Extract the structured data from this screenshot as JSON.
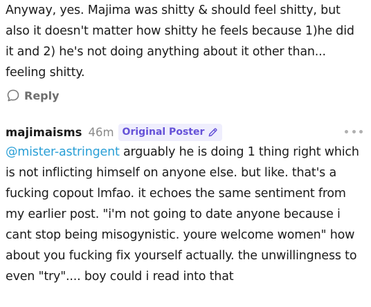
{
  "previous_comment": {
    "text": "Anyway, yes. Majima was shitty & should feel shitty, but also it doesn't matter how shitty he feels because 1)he did it and 2) he's not doing anything about it other than... feeling shitty."
  },
  "reply": {
    "label": "Reply",
    "icon": "speech-bubble-icon"
  },
  "comment": {
    "username": "majimaisms",
    "timestamp": "46m",
    "badge_label": "Original Poster",
    "badge_icon": "pencil-icon",
    "mention": "@mister-astringent",
    "body": " arguably he is doing 1 thing right which is not inflicting himself on anyone else. but like. that's a fucking copout lmfao. it echoes the same sentiment from my earlier post. \"i'm not going to date anyone because i cant stop being misogynistic. youre welcome women\" how about you fucking fix yourself actually. the unwillingness to even \"try\".... boy could i read into that",
    "more_icon": "ellipsis-icon"
  },
  "colors": {
    "mention": "#2a9fd6",
    "badge_bg": "#efeefd",
    "badge_text": "#6552d8",
    "muted": "#8a8a8a"
  }
}
